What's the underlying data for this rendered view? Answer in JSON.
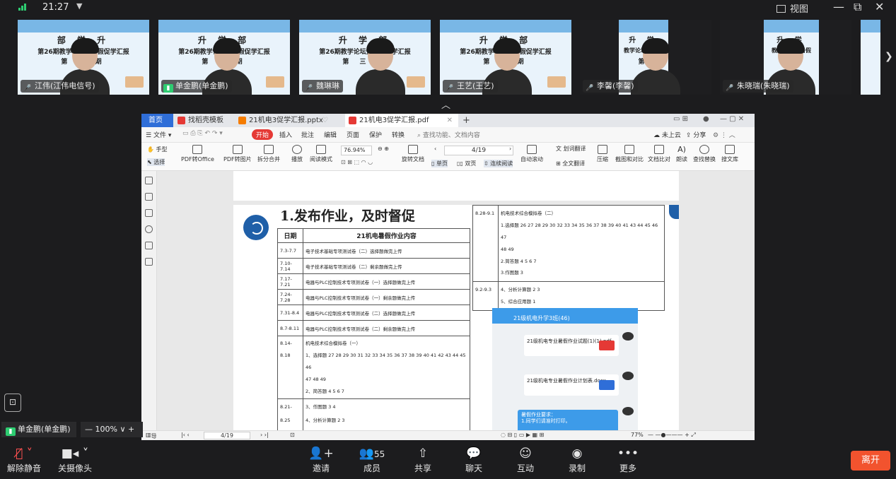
{
  "app": {
    "time": "21:27",
    "view_label": "视图",
    "window_controls": [
      "—",
      "⧉",
      "✕"
    ]
  },
  "participants": [
    {
      "name": "江伟(江伟电信号)",
      "mic": "off",
      "slide": {
        "t1": "部 学 升",
        "t2": "第26期教学论坛暨暑假促学汇报",
        "t3": "第 一 期"
      }
    },
    {
      "name": "单金鹏(单金鹏)",
      "mic": "on",
      "slide": {
        "t1": "升 学 部",
        "t2": "第26期教学论坛暨暑假促学汇报",
        "t3": "第 三 期"
      }
    },
    {
      "name": "魏琳琳",
      "mic": "off",
      "slide": {
        "t1": "升 学 部",
        "t2": "第26期教学论坛暨暑假促学汇报",
        "t3": "第 三 期"
      }
    },
    {
      "name": "王艺(王艺)",
      "mic": "off",
      "slide": {
        "t1": "升 学 部",
        "t2": "第26期教学论坛暨暑假促学汇报",
        "t3": "第 三 期"
      }
    },
    {
      "name": "李馨(李馨)",
      "mic": "off",
      "slide": {
        "t1": "升 学",
        "t2": "教学论坛暨暑假",
        "t3": "第"
      }
    },
    {
      "name": "朱晓瑞(朱晓瑞)",
      "mic": "off",
      "slide": {
        "t1": "升 学",
        "t2": "教学论坛暨暑假",
        "t3": "第"
      }
    }
  ],
  "share": {
    "tabs": {
      "home": "首页",
      "t1": "找稻壳模板",
      "t2": "21机电3促学汇报.pptx",
      "t3": "21机电3促学汇报.pdf"
    },
    "menus": {
      "file": "文件",
      "start": "开始",
      "insert": "插入",
      "annotate": "批注",
      "edit": "编辑",
      "page": "页面",
      "protect": "保护",
      "convert": "转换",
      "search": "查找功能、文档内容",
      "cloud": "未上云",
      "share": "分享"
    },
    "toolbar": {
      "hand": "手型",
      "select": "选择",
      "pdf_to_office": "PDF转Office",
      "pdf_to_image": "PDF转图片",
      "split_merge": "拆分合并",
      "play": "播放",
      "read_mode": "阅读模式",
      "zoom": "76.94%",
      "page": "4/19",
      "rotate": "旋转文档",
      "single": "单页",
      "double": "双页",
      "continuous": "连续阅读",
      "autoscroll": "自动滚动",
      "translate": "划词翻译",
      "full_translate": "全文翻译",
      "compress": "压缩",
      "screenshot": "截图和对比",
      "compare": "文档比对",
      "read_aloud": "朗读",
      "find_replace": "查找替换",
      "library": "搜文库"
    },
    "doc": {
      "heading": "1.发布作业，及时督促",
      "table_headers": [
        "日期",
        "21机电暑假作业内容"
      ],
      "rows": [
        {
          "date": "7.3-7.7",
          "content": "电子技术基础专项测试卷（二）选择题做完上传"
        },
        {
          "date": "7.10-7.14",
          "content": "电子技术基础专项测试卷（二）剩余题做完上传"
        },
        {
          "date": "7.17-7.21",
          "content": "电器与PLC控制技术专项测试卷（一）选择题做完上传"
        },
        {
          "date": "7.24-7.28",
          "content": "电器与PLC控制技术专项测试卷（一）剩余题做完上传"
        },
        {
          "date": "7.31-8.4",
          "content": "电器与PLC控制技术专项测试卷（二）选择题做完上传"
        },
        {
          "date": "8.7-8.11",
          "content": "电器与PLC控制技术专项测试卷（二）剩余题做完上传"
        }
      ],
      "row_814": {
        "date": "8.14-8.18",
        "l1": "机电技术综合模拟卷（一）",
        "l2": "1、选择题 27 28 29 30 31 32 33 34 35 36 37 38 39 40 41 42 43 44 45 46",
        "l3": "47 48 49",
        "l4": "2、简答题 4 5 6 7"
      },
      "row_821": {
        "date": "8.21-8.25",
        "l1": "3、作图题 3 4",
        "l2": "4、分析计算题 2 3"
      },
      "row_828": {
        "date": "8.28-9.1",
        "l1": "机电技术综合模拟卷（二）",
        "l2": "1.选择题 26 27 28 29 30 32 33 34 35 36 37 38 39 40 41 43 44 45 46 47",
        "l3": "48 49",
        "l4": "2.简答题 4 5 6 7",
        "l5": "3.作图题 3"
      },
      "row_92": {
        "date": "9.2-9.3",
        "l1": "4、分析计算题 2 3",
        "l2": "5、综合应用题 1"
      },
      "phone": {
        "title": "21级机电升学3班(46)",
        "file1": "21级机电专业暑假作业试题(1)(1).pdf",
        "file2": "21级机电专业暑假作业计划表.docx",
        "notice1": "暑假作业要求：",
        "notice2": "1.同学们请准时打印。"
      }
    },
    "status": {
      "nav": "导航",
      "page": "4/19",
      "zoom": "77%"
    }
  },
  "presenter": {
    "name": "单金鹏(单金鹏)",
    "zoom": "100%"
  },
  "controls": {
    "unmute": "解除静音",
    "camera": "关摄像头",
    "invite": "邀请",
    "members": "成员",
    "members_count": "55",
    "share": "共享",
    "chat": "聊天",
    "interact": "互动",
    "record": "录制",
    "more": "更多",
    "leave": "离开"
  }
}
